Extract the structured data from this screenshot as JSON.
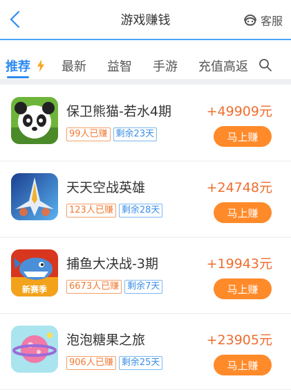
{
  "header": {
    "title": "游戏赚钱",
    "service_label": "客服"
  },
  "tabs": [
    {
      "label": "推荐",
      "active": true
    },
    {
      "label": "最新",
      "active": false
    },
    {
      "label": "益智",
      "active": false
    },
    {
      "label": "手游",
      "active": false
    },
    {
      "label": "充值高返",
      "active": false
    }
  ],
  "items": [
    {
      "name": "保卫熊猫-若水4期",
      "users": "99人已赚",
      "remaining": "剩余23天",
      "reward": "+49909元",
      "button": "马上赚",
      "icon": "panda-game-icon"
    },
    {
      "name": "天天空战英雄",
      "users": "123人已赚",
      "remaining": "剩余28天",
      "reward": "+24748元",
      "button": "马上赚",
      "icon": "fighter-jet-game-icon"
    },
    {
      "name": "捕鱼大决战-3期",
      "users": "6673人已赚",
      "remaining": "剩余7天",
      "reward": "+19943元",
      "button": "马上赚",
      "icon": "shark-fishing-game-icon",
      "icon_caption": "新赛季"
    },
    {
      "name": "泡泡糖果之旅",
      "users": "906人已赚",
      "remaining": "剩余25天",
      "reward": "+23905元",
      "button": "马上赚",
      "icon": "candy-planet-game-icon"
    }
  ],
  "colors": {
    "accent": "#2d8bf0",
    "reward": "#ef6d2f",
    "button": "#ff8a2a"
  }
}
